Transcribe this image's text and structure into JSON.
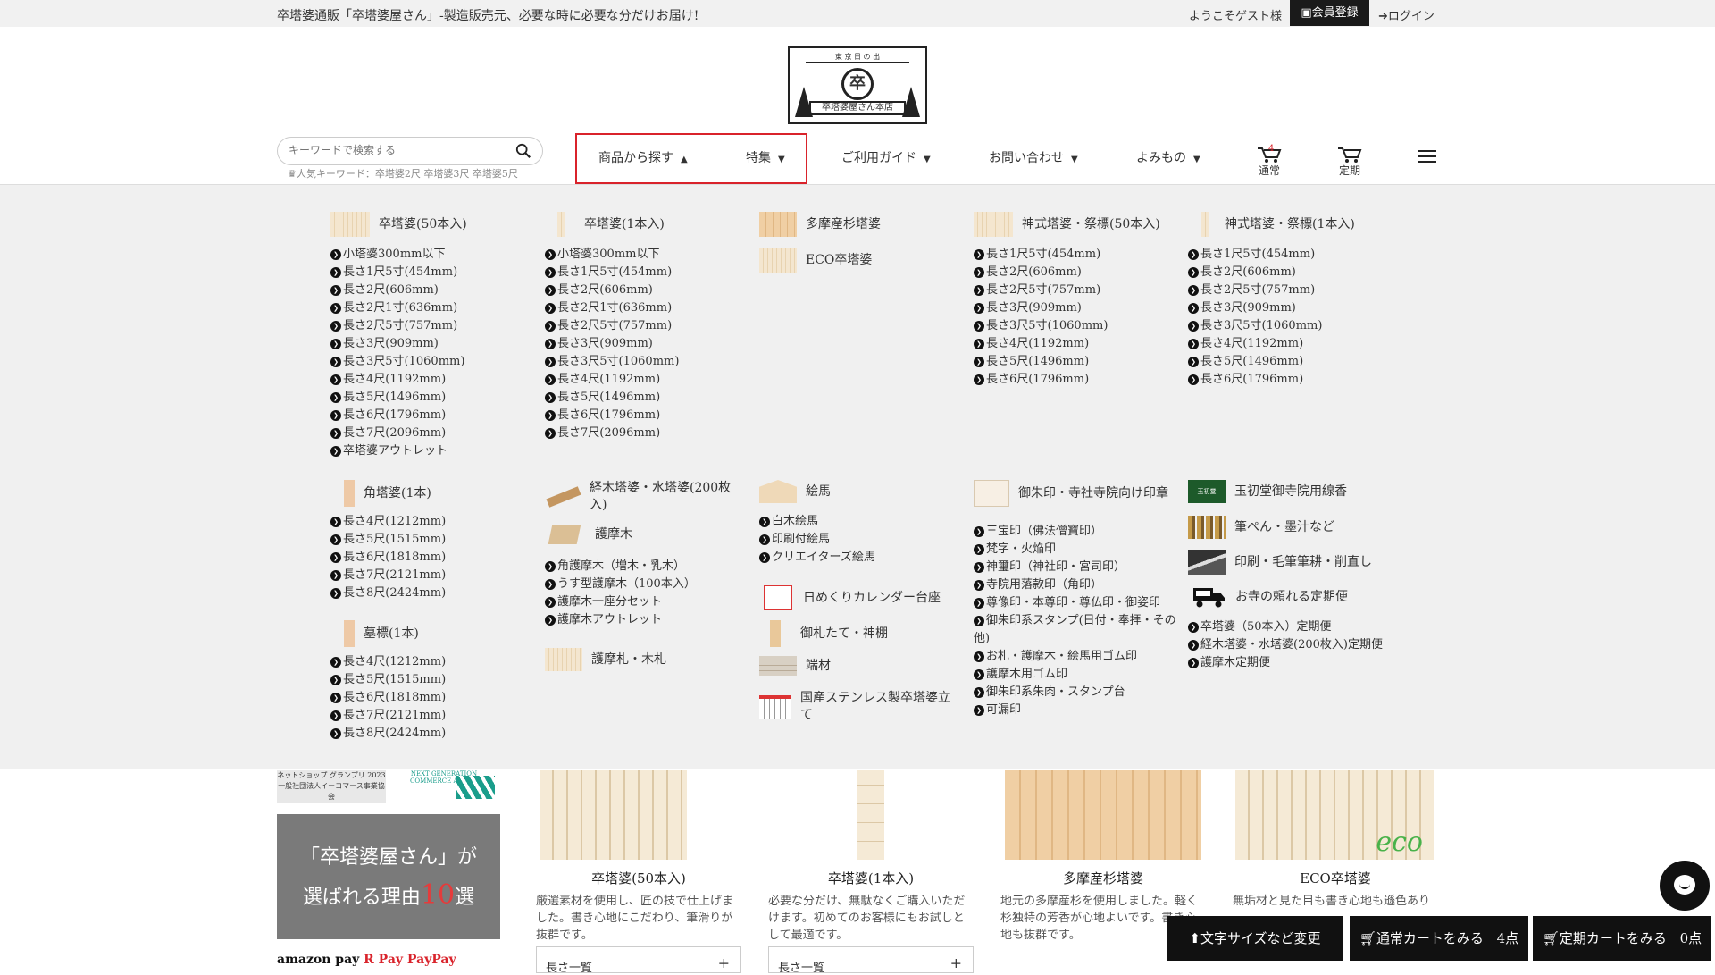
{
  "topbar": {
    "tagline": "卒塔婆通販「卒塔婆屋さん」-製造販売元、必要な時に必要な分だけお届け!",
    "welcome": "ようこそゲスト様",
    "register": "会員登録",
    "login": "ログイン"
  },
  "logo": {
    "char": "卒",
    "label": "卒塔婆屋さん本店",
    "top": "東 京 日 の 出"
  },
  "search": {
    "placeholder": "キーワードで検索する",
    "popular": "人気キーワード：卒塔婆2尺 卒塔婆3尺 卒塔婆5尺"
  },
  "nav": {
    "products": "商品から探す",
    "feature": "特集",
    "guide": "ご利用ガイド",
    "contact": "お問い合わせ",
    "reading": "よみもの",
    "cart_normal": "通常",
    "cart_badge": "4",
    "cart_regular": "定期"
  },
  "mega": {
    "sotoba50": {
      "title": "卒塔婆(50本入)",
      "items": [
        "小塔婆300mm以下",
        "長さ1尺5寸(454mm)",
        "長さ2尺(606mm)",
        "長さ2尺1寸(636mm)",
        "長さ2尺5寸(757mm)",
        "長さ3尺(909mm)",
        "長さ3尺5寸(1060mm)",
        "長さ4尺(1192mm)",
        "長さ5尺(1496mm)",
        "長さ6尺(1796mm)",
        "長さ7尺(2096mm)",
        "卒塔婆アウトレット"
      ]
    },
    "sotoba1": {
      "title": "卒塔婆(1本入)",
      "items": [
        "小塔婆300mm以下",
        "長さ1尺5寸(454mm)",
        "長さ2尺(606mm)",
        "長さ2尺1寸(636mm)",
        "長さ2尺5寸(757mm)",
        "長さ3尺(909mm)",
        "長さ3尺5寸(1060mm)",
        "長さ4尺(1192mm)",
        "長さ5尺(1496mm)",
        "長さ6尺(1796mm)",
        "長さ7尺(2096mm)"
      ]
    },
    "tama": {
      "title": "多摩産杉塔婆"
    },
    "eco": {
      "title": "ECO卒塔婆"
    },
    "shinto50": {
      "title": "神式塔婆・祭標(50本入)",
      "items": [
        "長さ1尺5寸(454mm)",
        "長さ2尺(606mm)",
        "長さ2尺5寸(757mm)",
        "長さ3尺(909mm)",
        "長さ3尺5寸(1060mm)",
        "長さ4尺(1192mm)",
        "長さ5尺(1496mm)",
        "長さ6尺(1796mm)"
      ]
    },
    "shinto1": {
      "title": "神式塔婆・祭標(1本入)",
      "items": [
        "長さ1尺5寸(454mm)",
        "長さ2尺(606mm)",
        "長さ2尺5寸(757mm)",
        "長さ3尺(909mm)",
        "長さ3尺5寸(1060mm)",
        "長さ4尺(1192mm)",
        "長さ5尺(1496mm)",
        "長さ6尺(1796mm)"
      ]
    },
    "kaku": {
      "title": "角塔婆(1本)",
      "items": [
        "長さ4尺(1212mm)",
        "長さ5尺(1515mm)",
        "長さ6尺(1818mm)",
        "長さ7尺(2121mm)",
        "長さ8尺(2424mm)"
      ]
    },
    "bohyo": {
      "title": "墓標(1本)",
      "items": [
        "長さ4尺(1212mm)",
        "長さ5尺(1515mm)",
        "長さ6尺(1818mm)",
        "長さ7尺(2121mm)",
        "長さ8尺(2424mm)"
      ]
    },
    "kyogi": {
      "title": "経木塔婆・水塔婆(200枚入)"
    },
    "goma": {
      "title": "護摩木",
      "items": [
        "角護摩木（増木・乳木）",
        "うす型護摩木（100本入）",
        "護摩木一座分セット",
        "護摩木アウトレット"
      ]
    },
    "gofuda": {
      "title": "護摩札・木札"
    },
    "ema": {
      "title": "絵馬",
      "items": [
        "白木絵馬",
        "印刷付絵馬",
        "クリエイターズ絵馬"
      ]
    },
    "calendar": {
      "title": "日めくりカレンダー台座"
    },
    "ofuda": {
      "title": "御札たて・神棚"
    },
    "hazai": {
      "title": "端材"
    },
    "stand": {
      "title": "国産ステンレス製卒塔婆立て"
    },
    "goshuin": {
      "title": "御朱印・寺社寺院向け印章",
      "items": [
        "三宝印（佛法僧寶印）",
        "梵字・火焔印",
        "神璽印（神社印・宮司印）",
        "寺院用落款印（角印）",
        "尊像印・本尊印・尊仏印・御姿印",
        "御朱印系スタンプ(日付・奉拝・その他)",
        "お札・護摩木・絵馬用ゴム印",
        "護摩木用ゴム印",
        "御朱印系朱肉・スタンプ台",
        "可漏印"
      ]
    },
    "senko": {
      "title": "玉初堂御寺院用線香",
      "logo": "玉初堂"
    },
    "fude": {
      "title": "筆ぺん・墨汁など"
    },
    "insatsu": {
      "title": "印刷・毛筆筆耕・削直し"
    },
    "teiki": {
      "title": "お寺の頼れる定期便",
      "items": [
        "卒塔婆（50本入）定期便",
        "経木塔婆・水塔婆(200枚入)定期便",
        "護摩木定期便"
      ]
    }
  },
  "lower": {
    "award1": "ネットショップ グランプリ 2023 一般社団法人イーコマース事業協会",
    "award2": "NEXT GENERATION COMMERCE AWARD",
    "reason_line1": "「卒塔婆屋さん」が",
    "reason_pre": "選ばれる理由",
    "reason_num": "10",
    "reason_post": "選",
    "pay": "amazon pay",
    "pay2": "R Pay",
    "pay3": "PayPay",
    "products": [
      {
        "title": "卒塔婆(50本入)",
        "desc": "厳選素材を使用し、匠の技で仕上げました。書き心地にこだわり、筆滑りが抜群です。",
        "select": "長さ一覧"
      },
      {
        "title": "卒塔婆(1本入)",
        "desc": "必要な分だけ、無駄なくご購入いただけます。初めてのお客様にもお試しとして最適です。",
        "select": "長さ一覧"
      },
      {
        "title": "多摩産杉塔婆",
        "desc": "地元の多摩産杉を使用しました。軽く杉独特の芳香が心地よいです。書き心地も抜群です。"
      },
      {
        "title": "ECO卒塔婆",
        "desc": "無垢材と見た目も書き心地も遜色ありません。"
      }
    ],
    "eco_mark": "eco"
  },
  "bottom": {
    "font_btn": "文字サイズなど変更",
    "cart_normal": "通常カートをみる",
    "cart_normal_count": "4点",
    "cart_regular": "定期カートをみる",
    "cart_regular_count": "0点"
  }
}
